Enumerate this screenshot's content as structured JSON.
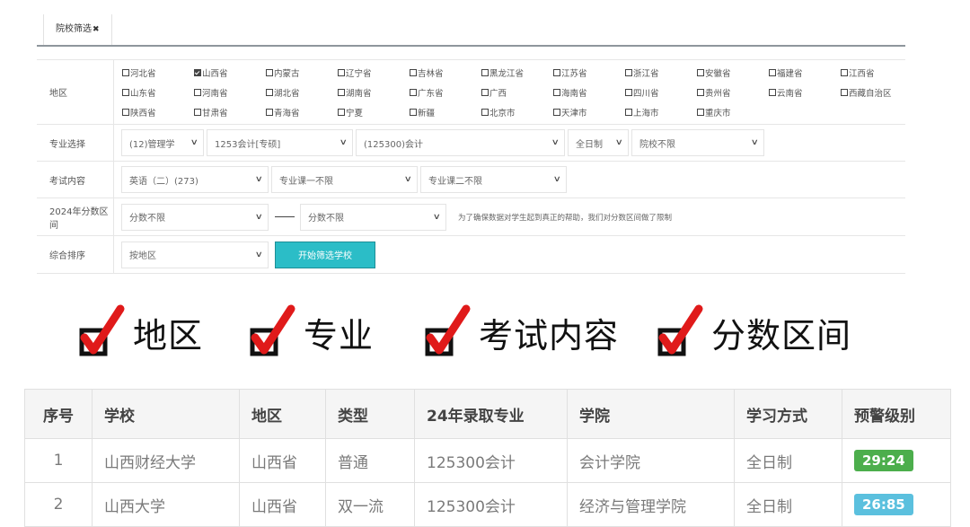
{
  "tab": {
    "label": "院校筛选",
    "close": "✖"
  },
  "filters": {
    "region": {
      "label": "地区",
      "items": [
        {
          "name": "河北省",
          "checked": false
        },
        {
          "name": "山西省",
          "checked": true
        },
        {
          "name": "内蒙古",
          "checked": false
        },
        {
          "name": "辽宁省",
          "checked": false
        },
        {
          "name": "吉林省",
          "checked": false
        },
        {
          "name": "黑龙江省",
          "checked": false
        },
        {
          "name": "江苏省",
          "checked": false
        },
        {
          "name": "浙江省",
          "checked": false
        },
        {
          "name": "安徽省",
          "checked": false
        },
        {
          "name": "福建省",
          "checked": false
        },
        {
          "name": "江西省",
          "checked": false
        },
        {
          "name": "山东省",
          "checked": false
        },
        {
          "name": "河南省",
          "checked": false
        },
        {
          "name": "湖北省",
          "checked": false
        },
        {
          "name": "湖南省",
          "checked": false
        },
        {
          "name": "广东省",
          "checked": false
        },
        {
          "name": "广西",
          "checked": false
        },
        {
          "name": "海南省",
          "checked": false
        },
        {
          "name": "四川省",
          "checked": false
        },
        {
          "name": "贵州省",
          "checked": false
        },
        {
          "name": "云南省",
          "checked": false
        },
        {
          "name": "西藏自治区",
          "checked": false
        },
        {
          "name": "陕西省",
          "checked": false
        },
        {
          "name": "甘肃省",
          "checked": false
        },
        {
          "name": "青海省",
          "checked": false
        },
        {
          "name": "宁夏",
          "checked": false
        },
        {
          "name": "新疆",
          "checked": false
        },
        {
          "name": "北京市",
          "checked": false
        },
        {
          "name": "天津市",
          "checked": false
        },
        {
          "name": "上海市",
          "checked": false
        },
        {
          "name": "重庆市",
          "checked": false
        }
      ]
    },
    "major": {
      "label": "专业选择",
      "category": "(12)管理学",
      "subject": "1253会计[专硕]",
      "direction": "(125300)会计",
      "mode": "全日制",
      "school": "院校不限"
    },
    "exam": {
      "label": "考试内容",
      "english": "英语（二）(273)",
      "course1": "专业课一不限",
      "course2": "专业课二不限"
    },
    "score": {
      "label": "2024年分数区间",
      "from": "分数不限",
      "to": "分数不限",
      "hint": "为了确保数据对学生起到真正的帮助，我们对分数区间做了限制"
    },
    "sort": {
      "label": "综合排序",
      "value": "按地区",
      "button": "开始筛选学校"
    }
  },
  "checks": [
    {
      "label": "地区"
    },
    {
      "label": "专业"
    },
    {
      "label": "考试内容"
    },
    {
      "label": "分数区间"
    }
  ],
  "table": {
    "headers": [
      "序号",
      "学校",
      "地区",
      "类型",
      "24年录取专业",
      "学院",
      "学习方式",
      "预警级别"
    ],
    "rows": [
      {
        "idx": "1",
        "school": "山西财经大学",
        "region": "山西省",
        "type": "普通",
        "major": "125300会计",
        "college": "会计学院",
        "mode": "全日制",
        "level": "29:24",
        "level_color": "#4cae4c"
      },
      {
        "idx": "2",
        "school": "山西大学",
        "region": "山西省",
        "type": "双一流",
        "major": "125300会计",
        "college": "经济与管理学院",
        "mode": "全日制",
        "level": "26:85",
        "level_color": "#5bc0de"
      }
    ]
  },
  "colors": {
    "check_red": "#e01a1a",
    "button": "#2bbdc7"
  }
}
